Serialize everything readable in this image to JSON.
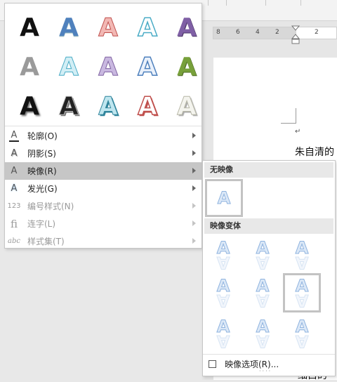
{
  "document": {
    "ruler_ticks": [
      "8",
      "6",
      "4",
      "2",
      "2"
    ],
    "return_mark": "↵",
    "line1": "朱自清的",
    "line2": "细白的"
  },
  "menu": {
    "items": [
      {
        "label": "轮廓(O)",
        "icon": "outline-A-icon"
      },
      {
        "label": "阴影(S)",
        "icon": "shadow-A-icon"
      },
      {
        "label": "映像(R)",
        "icon": "reflection-A-icon"
      },
      {
        "label": "发光(G)",
        "icon": "glow-A-icon"
      },
      {
        "label": "编号样式(N)",
        "icon": "number-style-icon",
        "icon_text": "123"
      },
      {
        "label": "连字(L)",
        "icon": "ligature-icon",
        "icon_text": "fi"
      },
      {
        "label": "样式集(T)",
        "icon": "stylistic-set-icon",
        "icon_text": "abc"
      }
    ],
    "gallery_letter": "A"
  },
  "submenu": {
    "no_reflection_header": "无映像",
    "variations_header": "映像变体",
    "options_label": "映像选项(R)...",
    "letter": "A"
  },
  "colors": {
    "menu_active": "#c6c6c6",
    "reflection_fill": "#dbe8f7",
    "reflection_stroke": "#8fb3df"
  }
}
